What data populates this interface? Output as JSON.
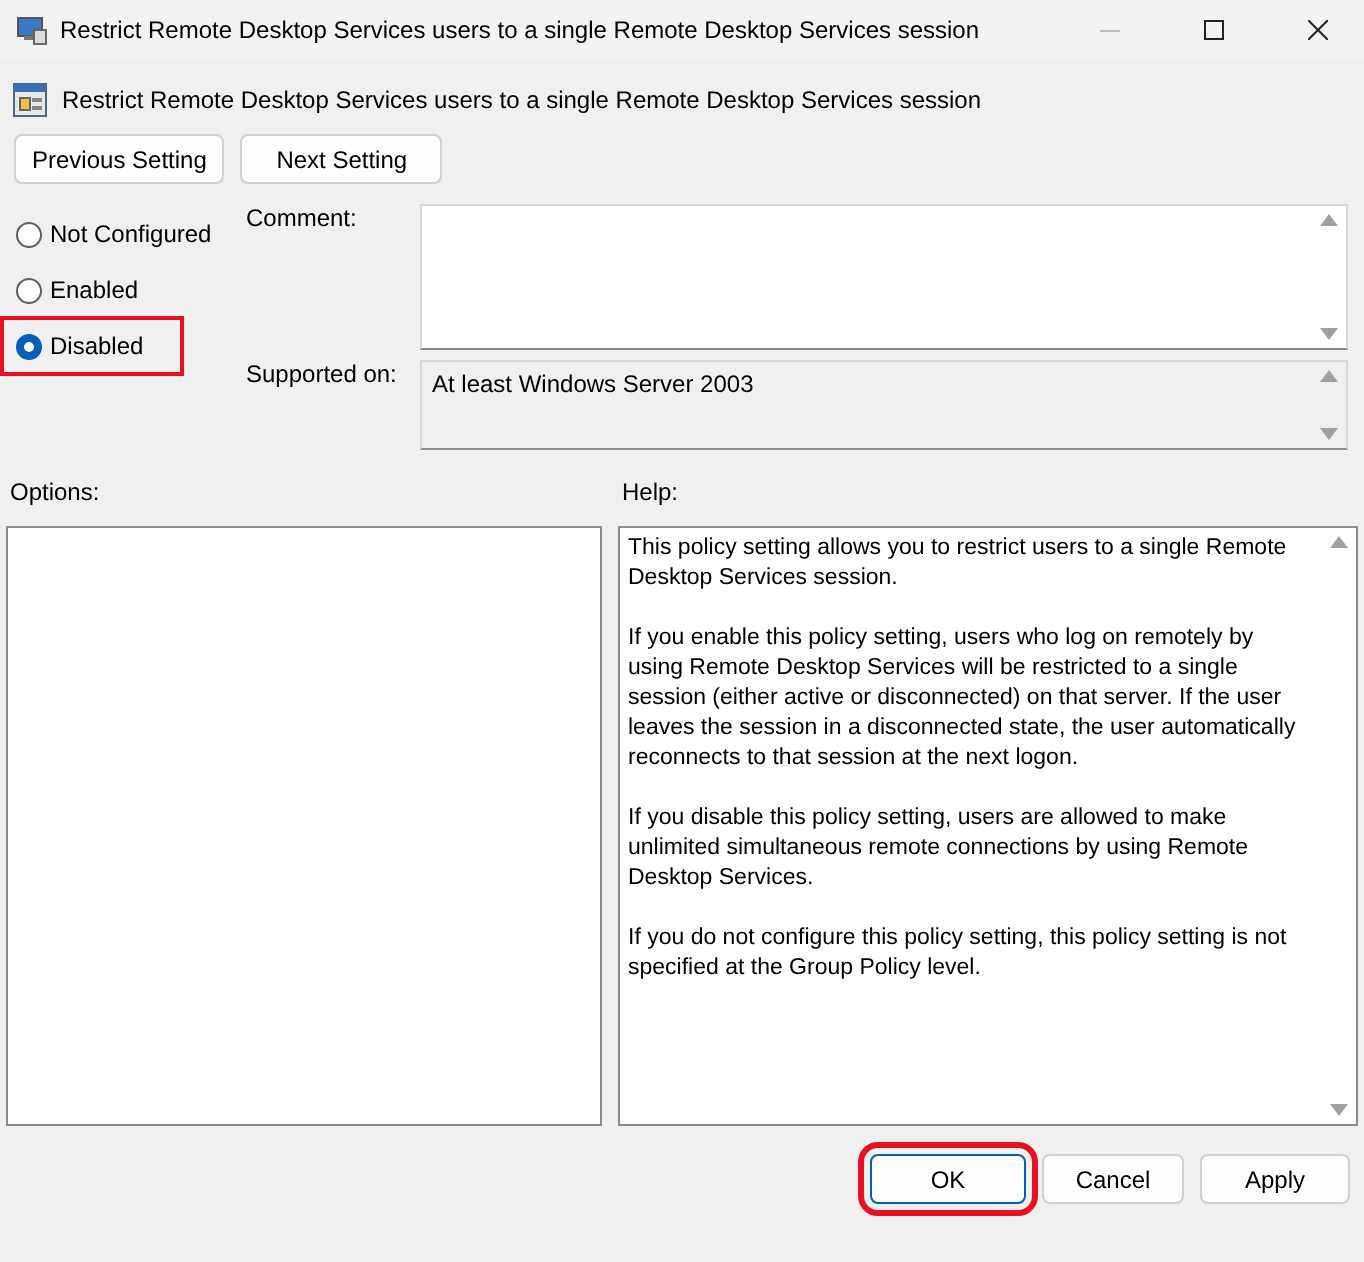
{
  "window": {
    "title": "Restrict Remote Desktop Services users to a single Remote Desktop Services session"
  },
  "header": {
    "title": "Restrict Remote Desktop Services users to a single Remote Desktop Services session"
  },
  "nav_buttons": [
    "Previous Setting",
    "Next Setting"
  ],
  "state_options": [
    {
      "label": "Not Configured",
      "selected": false,
      "highlighted": false
    },
    {
      "label": "Enabled",
      "selected": false,
      "highlighted": false
    },
    {
      "label": "Disabled",
      "selected": true,
      "highlighted": true
    }
  ],
  "comment": {
    "label": "Comment:"
  },
  "supported_on": {
    "label": "Supported on:",
    "value": "At least Windows Server 2003"
  },
  "options": {
    "label": "Options:"
  },
  "help": {
    "label": "Help:",
    "paragraphs": [
      "This policy setting allows you to restrict users to a single Remote Desktop Services session.",
      "If you enable this policy setting, users who log on remotely by using Remote Desktop Services will be restricted to a single session (either active or disconnected) on that server. If the user leaves the session in a disconnected state, the user automatically reconnects to that session at the next logon.",
      "If you disable this policy setting, users are allowed to make unlimited simultaneous remote connections by using Remote Desktop Services.",
      "If you do not configure this policy setting,  this policy setting is not specified at the Group Policy level."
    ]
  },
  "buttons": [
    {
      "label": "OK",
      "highlighted": true
    },
    {
      "label": "Cancel",
      "highlighted": false
    },
    {
      "label": "Apply",
      "highlighted": false
    }
  ]
}
